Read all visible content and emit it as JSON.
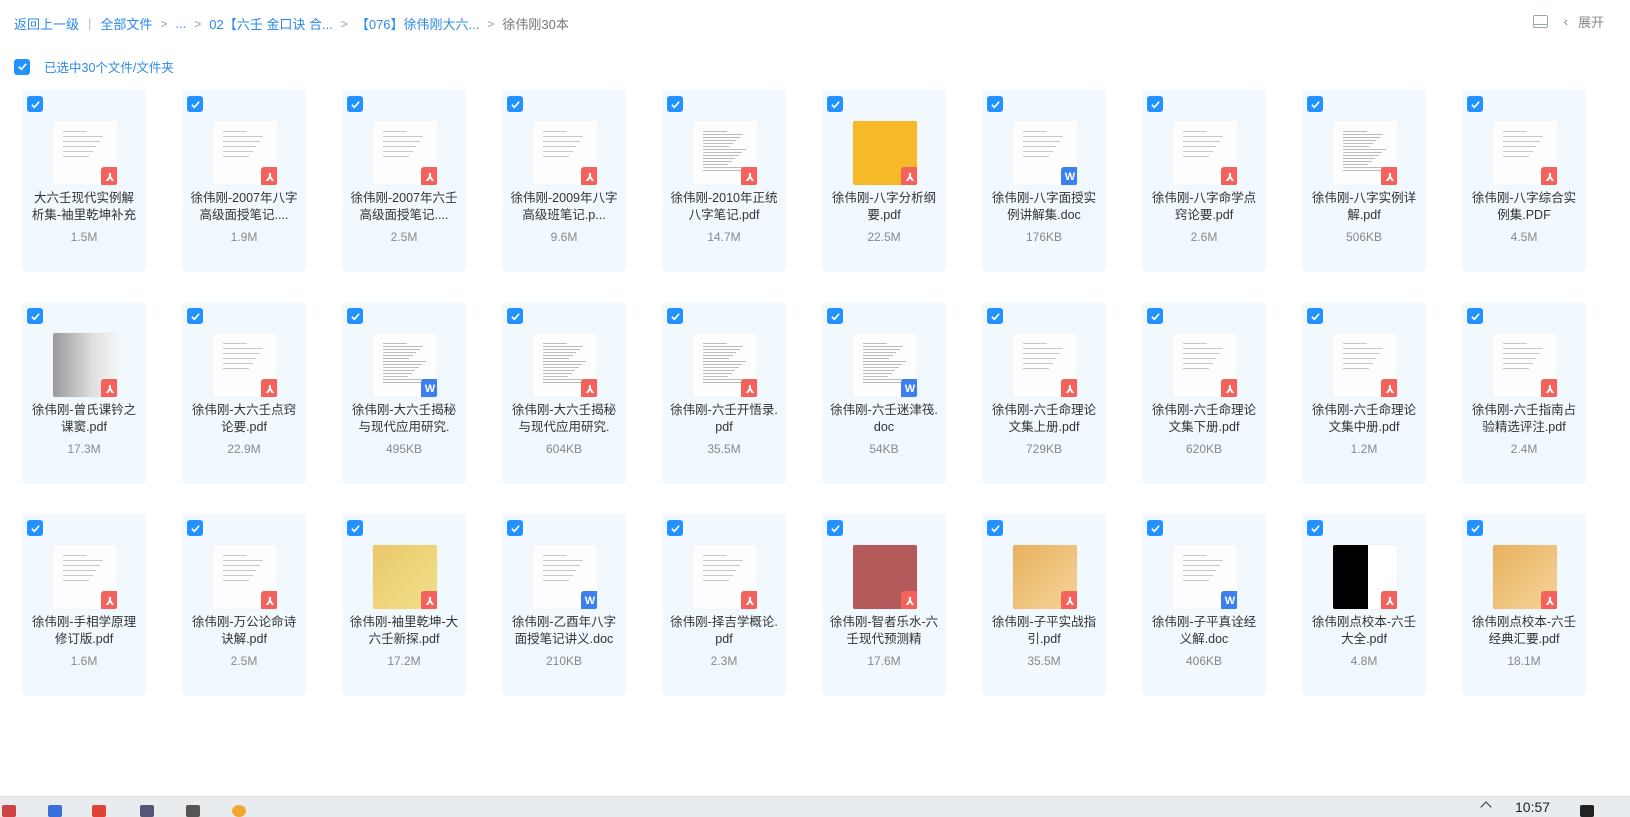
{
  "breadcrumb": {
    "back": "返回上一级",
    "all_files": "全部文件",
    "ellipsis": "...",
    "level1": "02【六壬 金口诀 合...",
    "level2": "【076】徐伟刚大六...",
    "current": "徐伟刚30本"
  },
  "toolbar": {
    "expand_label": "展开",
    "expand_chevron": "‹"
  },
  "selection": {
    "label": "已选中30个文件/文件夹"
  },
  "files": [
    {
      "name": "大六壬现代实例解析集-袖里乾坤补充",
      "size": "1.5M",
      "type": "pdf"
    },
    {
      "name": "徐伟刚-2007年八字高级面授笔记....",
      "size": "1.9M",
      "type": "pdf"
    },
    {
      "name": "徐伟刚-2007年六壬高级面授笔记....",
      "size": "2.5M",
      "type": "pdf"
    },
    {
      "name": "徐伟刚-2009年八字高级班笔记.p...",
      "size": "9.6M",
      "type": "pdf"
    },
    {
      "name": "徐伟刚-2010年正统八字笔记.pdf",
      "size": "14.7M",
      "type": "pdf"
    },
    {
      "name": "徐伟刚-八字分析纲要.pdf",
      "size": "22.5M",
      "type": "pdf"
    },
    {
      "name": "徐伟刚-八字面授实例讲解集.doc",
      "size": "176KB",
      "type": "doc"
    },
    {
      "name": "徐伟刚-八字命学点窍论要.pdf",
      "size": "2.6M",
      "type": "pdf"
    },
    {
      "name": "徐伟刚-八字实例详解.pdf",
      "size": "506KB",
      "type": "pdf"
    },
    {
      "name": "徐伟刚-八字综合实例集.PDF",
      "size": "4.5M",
      "type": "pdf"
    },
    {
      "name": "徐伟刚-曾氏课钤之课窦.pdf",
      "size": "17.3M",
      "type": "pdf"
    },
    {
      "name": "徐伟刚-大六壬点窍论要.pdf",
      "size": "22.9M",
      "type": "pdf"
    },
    {
      "name": "徐伟刚-大六壬揭秘与现代应用研究.",
      "size": "495KB",
      "type": "doc"
    },
    {
      "name": "徐伟刚-大六壬揭秘与现代应用研究.",
      "size": "604KB",
      "type": "pdf"
    },
    {
      "name": "徐伟刚-六壬开悟录.pdf",
      "size": "35.5M",
      "type": "pdf"
    },
    {
      "name": "徐伟刚-六壬迷津筏.doc",
      "size": "54KB",
      "type": "doc"
    },
    {
      "name": "徐伟刚-六壬命理论文集上册.pdf",
      "size": "729KB",
      "type": "pdf"
    },
    {
      "name": "徐伟刚-六壬命理论文集下册.pdf",
      "size": "620KB",
      "type": "pdf"
    },
    {
      "name": "徐伟刚-六壬命理论文集中册.pdf",
      "size": "1.2M",
      "type": "pdf"
    },
    {
      "name": "徐伟刚-六壬指南占验精选评注.pdf",
      "size": "2.4M",
      "type": "pdf"
    },
    {
      "name": "徐伟刚-手相学原理修订版.pdf",
      "size": "1.6M",
      "type": "pdf"
    },
    {
      "name": "徐伟刚-万公论命诗诀解.pdf",
      "size": "2.5M",
      "type": "pdf"
    },
    {
      "name": "徐伟刚-袖里乾坤-大六壬新探.pdf",
      "size": "17.2M",
      "type": "pdf"
    },
    {
      "name": "徐伟刚-乙酉年八字面授笔记讲义.doc",
      "size": "210KB",
      "type": "doc"
    },
    {
      "name": "徐伟刚-择吉学概论.pdf",
      "size": "2.3M",
      "type": "pdf"
    },
    {
      "name": "徐伟刚-智者乐水-六壬现代预测精",
      "size": "17.6M",
      "type": "pdf"
    },
    {
      "name": "徐伟刚-子平实战指引.pdf",
      "size": "35.5M",
      "type": "pdf"
    },
    {
      "name": "徐伟刚-子平真诠经义解.doc",
      "size": "406KB",
      "type": "doc"
    },
    {
      "name": "徐伟刚点校本-六壬大全.pdf",
      "size": "4.8M",
      "type": "pdf"
    },
    {
      "name": "徐伟刚点校本-六壬经典汇要.pdf",
      "size": "18.1M",
      "type": "pdf"
    }
  ],
  "taskbar": {
    "time": "10:57"
  },
  "colors": {
    "accent": "#2391ff",
    "link": "#2a8ae8",
    "card_bg": "#f1f8fe",
    "pdf": "#f4625b",
    "doc": "#3d7ff0"
  }
}
